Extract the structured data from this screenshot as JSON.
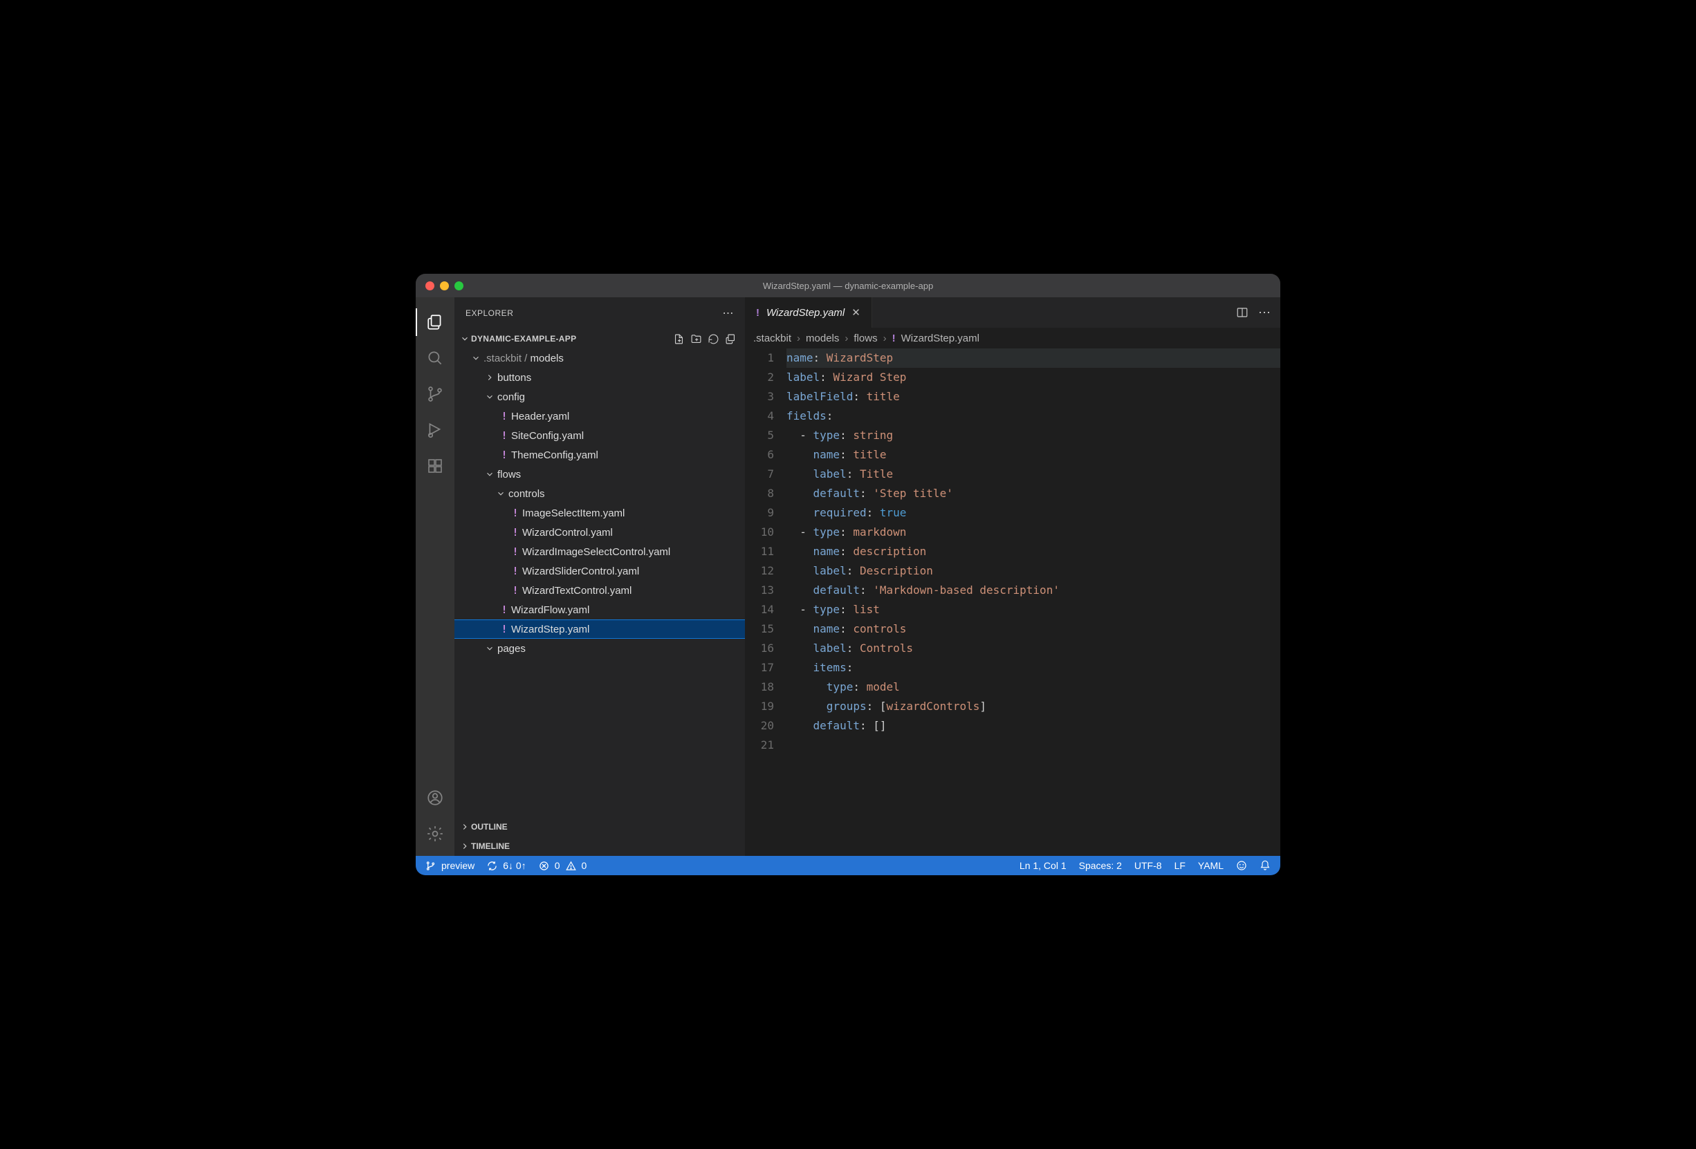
{
  "titlebar": {
    "title": "WizardStep.yaml — dynamic-example-app"
  },
  "activity": {
    "items": [
      "explorer",
      "search",
      "source-control",
      "run-debug",
      "extensions"
    ],
    "bottom": [
      "accounts",
      "manage"
    ]
  },
  "explorer": {
    "title": "EXPLORER",
    "project": "DYNAMIC-EXAMPLE-APP",
    "tree": {
      "rootDim": ".stackbit / ",
      "rootStrong": "models",
      "buttons": "buttons",
      "config": "config",
      "configFiles": [
        "Header.yaml",
        "SiteConfig.yaml",
        "ThemeConfig.yaml"
      ],
      "flows": "flows",
      "controls": "controls",
      "controlsFiles": [
        "ImageSelectItem.yaml",
        "WizardControl.yaml",
        "WizardImageSelectControl.yaml",
        "WizardSliderControl.yaml",
        "WizardTextControl.yaml"
      ],
      "wizardFlow": "WizardFlow.yaml",
      "wizardStep": "WizardStep.yaml",
      "pages": "pages"
    },
    "outline": "OUTLINE",
    "timeline": "TIMELINE"
  },
  "editor": {
    "tab": {
      "name": "WizardStep.yaml"
    },
    "crumbs": [
      ".stackbit",
      "models",
      "flows",
      "WizardStep.yaml"
    ],
    "lines": [
      [
        [
          "k",
          "name"
        ],
        [
          "c",
          ": "
        ],
        [
          "s",
          "WizardStep"
        ]
      ],
      [
        [
          "k",
          "label"
        ],
        [
          "c",
          ": "
        ],
        [
          "s",
          "Wizard Step"
        ]
      ],
      [
        [
          "k",
          "labelField"
        ],
        [
          "c",
          ": "
        ],
        [
          "s",
          "title"
        ]
      ],
      [
        [
          "k",
          "fields"
        ],
        [
          "c",
          ":"
        ]
      ],
      [
        [
          "d",
          "  - "
        ],
        [
          "k",
          "type"
        ],
        [
          "c",
          ": "
        ],
        [
          "s",
          "string"
        ]
      ],
      [
        [
          "d",
          "    "
        ],
        [
          "k",
          "name"
        ],
        [
          "c",
          ": "
        ],
        [
          "s",
          "title"
        ]
      ],
      [
        [
          "d",
          "    "
        ],
        [
          "k",
          "label"
        ],
        [
          "c",
          ": "
        ],
        [
          "s",
          "Title"
        ]
      ],
      [
        [
          "d",
          "    "
        ],
        [
          "k",
          "default"
        ],
        [
          "c",
          ": "
        ],
        [
          "s",
          "'Step title'"
        ]
      ],
      [
        [
          "d",
          "    "
        ],
        [
          "k",
          "required"
        ],
        [
          "c",
          ": "
        ],
        [
          "b",
          "true"
        ]
      ],
      [
        [
          "d",
          "  - "
        ],
        [
          "k",
          "type"
        ],
        [
          "c",
          ": "
        ],
        [
          "s",
          "markdown"
        ]
      ],
      [
        [
          "d",
          "    "
        ],
        [
          "k",
          "name"
        ],
        [
          "c",
          ": "
        ],
        [
          "s",
          "description"
        ]
      ],
      [
        [
          "d",
          "    "
        ],
        [
          "k",
          "label"
        ],
        [
          "c",
          ": "
        ],
        [
          "s",
          "Description"
        ]
      ],
      [
        [
          "d",
          "    "
        ],
        [
          "k",
          "default"
        ],
        [
          "c",
          ": "
        ],
        [
          "s",
          "'Markdown-based description'"
        ]
      ],
      [
        [
          "d",
          "  - "
        ],
        [
          "k",
          "type"
        ],
        [
          "c",
          ": "
        ],
        [
          "s",
          "list"
        ]
      ],
      [
        [
          "d",
          "    "
        ],
        [
          "k",
          "name"
        ],
        [
          "c",
          ": "
        ],
        [
          "s",
          "controls"
        ]
      ],
      [
        [
          "d",
          "    "
        ],
        [
          "k",
          "label"
        ],
        [
          "c",
          ": "
        ],
        [
          "s",
          "Controls"
        ]
      ],
      [
        [
          "d",
          "    "
        ],
        [
          "k",
          "items"
        ],
        [
          "c",
          ":"
        ]
      ],
      [
        [
          "d",
          "      "
        ],
        [
          "k",
          "type"
        ],
        [
          "c",
          ": "
        ],
        [
          "s",
          "model"
        ]
      ],
      [
        [
          "d",
          "      "
        ],
        [
          "k",
          "groups"
        ],
        [
          "c",
          ": "
        ],
        [
          "c",
          "["
        ],
        [
          "s",
          "wizardControls"
        ],
        [
          "c",
          "]"
        ]
      ],
      [
        [
          "d",
          "    "
        ],
        [
          "k",
          "default"
        ],
        [
          "c",
          ": "
        ],
        [
          "c",
          "[]"
        ]
      ],
      [
        [
          "",
          ""
        ]
      ]
    ]
  },
  "status": {
    "branch": "preview",
    "sync": "6↓ 0↑",
    "errors": "0",
    "warnings": "0",
    "pos": "Ln 1, Col 1",
    "spaces": "Spaces: 2",
    "encoding": "UTF-8",
    "eol": "LF",
    "lang": "YAML"
  }
}
